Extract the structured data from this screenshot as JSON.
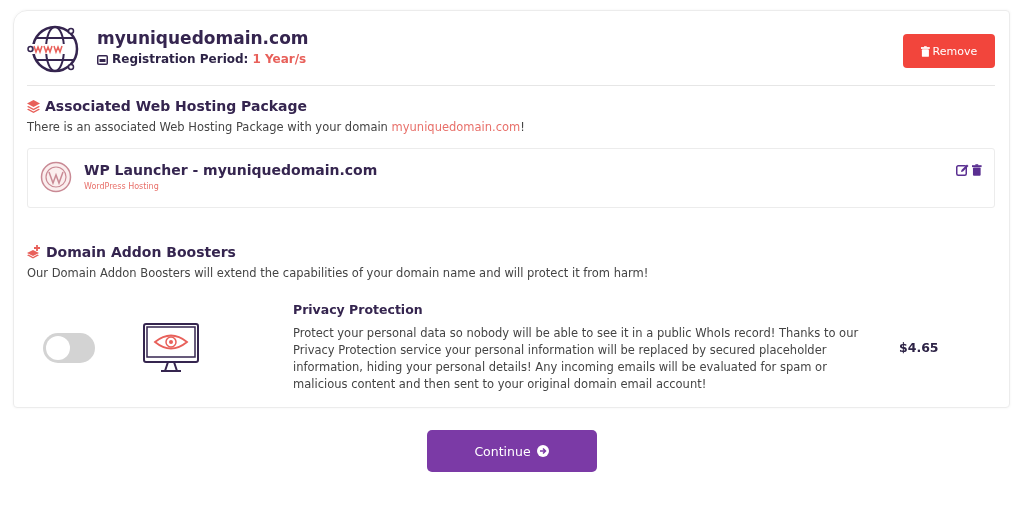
{
  "domain": {
    "name": "myuniquedomain.com",
    "period_label": "Registration Period:",
    "period_value": "1 Year/s",
    "remove_button": "Remove"
  },
  "hosting": {
    "title": "Associated Web Hosting Package",
    "text_before": "There is an associated Web Hosting Package with your domain ",
    "link": "myuniquedomain.com",
    "text_after": "!",
    "package": {
      "name": "WP Launcher - myuniquedomain.com",
      "type": "WordPress Hosting"
    }
  },
  "addons": {
    "title": "Domain Addon Boosters",
    "description": "Our Domain Addon Boosters will extend the capabilities of your domain name and will protect it from harm!",
    "items": [
      {
        "name": "Privacy Protection",
        "on": false,
        "description": "Protect your personal data so nobody will be able to see it in a public WhoIs record! Thanks to our Privacy Protection service your personal information will be replaced by secured placeholder information, hiding your personal details! Any incoming emails will be evaluated for spam or malicious content and then sent to your original domain email account!",
        "price": "$4.65"
      }
    ]
  },
  "continue_button": "Continue"
}
